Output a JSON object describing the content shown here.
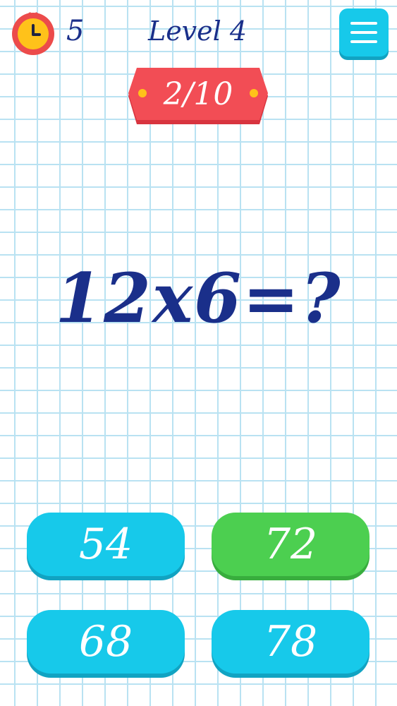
{
  "header": {
    "timer_icon": "stopwatch-icon",
    "timer_count": "5",
    "level_title": "Level 4",
    "menu_icon": "hamburger-menu-icon"
  },
  "progress": {
    "label": "2/10",
    "current": 2,
    "total": 10
  },
  "question": {
    "text": "12x6=?"
  },
  "answers": [
    {
      "label": "54",
      "state": "default"
    },
    {
      "label": "72",
      "state": "correct"
    },
    {
      "label": "68",
      "state": "default"
    },
    {
      "label": "78",
      "state": "default"
    }
  ],
  "colors": {
    "ink": "#1a2f8a",
    "grid_line": "#b9e2f2",
    "button_blue": "#17c9ea",
    "button_green": "#4ccf50",
    "ribbon_red": "#f24d55",
    "timer_red": "#ec4b4b",
    "timer_yellow": "#ffc21a"
  }
}
